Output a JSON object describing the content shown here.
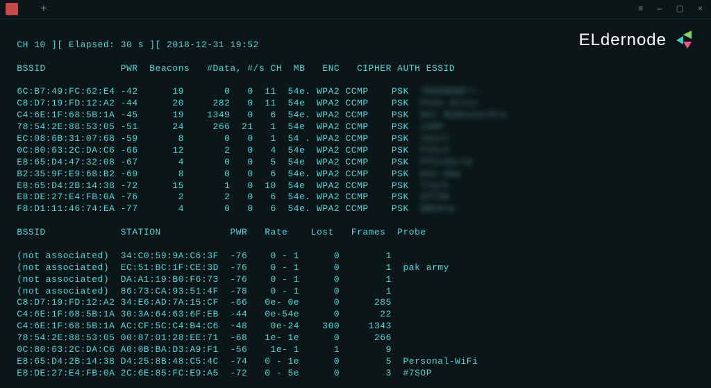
{
  "window": {
    "tab_label": "",
    "new_tab": "+"
  },
  "header_line": " CH 10 ][ Elapsed: 30 s ][ 2018-12-31 19:52",
  "ap_header": {
    "bssid": "BSSID",
    "pwr": "PWR",
    "beacons": "Beacons",
    "data": "#Data,",
    "per_s": "#/s",
    "ch": "CH",
    "mb": "MB",
    "enc": "ENC",
    "cipher": "CIPHER",
    "auth": "AUTH",
    "essid": "ESSID"
  },
  "aps": [
    {
      "bssid": "6C:B7:49:FC:62:E4",
      "pwr": "-42",
      "beacons": "19",
      "data": "0",
      "ps": "0",
      "ch": "11",
      "mb": "54e.",
      "enc": "WPA2",
      "cipher": "CCMP",
      "auth": "PSK",
      "essid": "TRUENODE!!"
    },
    {
      "bssid": "C8:D7:19:FD:12:A2",
      "pwr": "-44",
      "beacons": "20",
      "data": "282",
      "ps": "0",
      "ch": "11",
      "mb": "54e",
      "enc": "WPA2",
      "cipher": "CCMP",
      "auth": "PSK",
      "essid": "Pine Attic"
    },
    {
      "bssid": "C4:6E:1F:68:5B:1A",
      "pwr": "-45",
      "beacons": "19",
      "data": "1349",
      "ps": "0",
      "ch": "6",
      "mb": "54e.",
      "enc": "WPA2",
      "cipher": "CCMP",
      "auth": "PSK",
      "essid": "Net MyRouterPro"
    },
    {
      "bssid": "78:54:2E:88:53:05",
      "pwr": "-51",
      "beacons": "24",
      "data": "266",
      "ps": "21",
      "ch": "1",
      "mb": "54e",
      "enc": "WPA2",
      "cipher": "CCMP",
      "auth": "PSK",
      "essid": "LOOP"
    },
    {
      "bssid": "EC:08:6B:31:07:68",
      "pwr": "-59",
      "beacons": "8",
      "data": "0",
      "ps": "0",
      "ch": "1",
      "mb": "54 .",
      "enc": "WPA2",
      "cipher": "CCMP",
      "auth": "PSK",
      "essid": "Jazz1"
    },
    {
      "bssid": "0C:80:63:2C:DA:C6",
      "pwr": "-66",
      "beacons": "12",
      "data": "2",
      "ps": "0",
      "ch": "4",
      "mb": "54e",
      "enc": "WPA2",
      "cipher": "CCMP",
      "auth": "PSK",
      "essid": "PTCL4"
    },
    {
      "bssid": "E8:65:D4:47:32:08",
      "pwr": "-67",
      "beacons": "4",
      "data": "0",
      "ps": "0",
      "ch": "5",
      "mb": "54e",
      "enc": "WPA2",
      "cipher": "CCMP",
      "auth": "PSK",
      "essid": "PTCLhbLtd"
    },
    {
      "bssid": "B2:35:9F:E9:68:B2",
      "pwr": "-69",
      "beacons": "8",
      "data": "0",
      "ps": "0",
      "ch": "6",
      "mb": "54e.",
      "enc": "WPA2",
      "cipher": "CCMP",
      "auth": "PSK",
      "essid": "Kas-dbw"
    },
    {
      "bssid": "E8:65:D4:2B:14:38",
      "pwr": "-72",
      "beacons": "15",
      "data": "1",
      "ps": "0",
      "ch": "10",
      "mb": "54e",
      "enc": "WPA2",
      "cipher": "CCMP",
      "auth": "PSK",
      "essid": "Tlark"
    },
    {
      "bssid": "E8:DE:27:E4:FB:0A",
      "pwr": "-76",
      "beacons": "2",
      "data": "2",
      "ps": "0",
      "ch": "6",
      "mb": "54e.",
      "enc": "WPA2",
      "cipher": "CCMP",
      "auth": "PSK",
      "essid": "ATTIN"
    },
    {
      "bssid": "F8:D1:11:46:74:EA",
      "pwr": "-77",
      "beacons": "4",
      "data": "0",
      "ps": "0",
      "ch": "6",
      "mb": "54e.",
      "enc": "WPA2",
      "cipher": "CCMP",
      "auth": "PSK",
      "essid": "DBnetw"
    }
  ],
  "station_header": {
    "bssid": "BSSID",
    "station": "STATION",
    "pwr": "PWR",
    "rate": "Rate",
    "lost": "Lost",
    "frames": "Frames",
    "probe": "Probe"
  },
  "stations": [
    {
      "bssid": "(not associated)",
      "station": "34:C0:59:9A:C6:3F",
      "pwr": "-76",
      "rate": "0 - 1",
      "lost": "0",
      "frames": "1",
      "probe": ""
    },
    {
      "bssid": "(not associated)",
      "station": "EC:51:BC:1F:CE:3D",
      "pwr": "-76",
      "rate": "0 - 1",
      "lost": "0",
      "frames": "1",
      "probe": "pak army"
    },
    {
      "bssid": "(not associated)",
      "station": "DA:A1:19:B0:F6:73",
      "pwr": "-76",
      "rate": "0 - 1",
      "lost": "0",
      "frames": "1",
      "probe": ""
    },
    {
      "bssid": "(not associated)",
      "station": "86:73:CA:93:51:4F",
      "pwr": "-78",
      "rate": "0 - 1",
      "lost": "0",
      "frames": "1",
      "probe": ""
    },
    {
      "bssid": "C8:D7:19:FD:12:A2",
      "station": "34:E6:AD:7A:15:CF",
      "pwr": "-66",
      "rate": "0e- 0e",
      "lost": "0",
      "frames": "285",
      "probe": ""
    },
    {
      "bssid": "C4:6E:1F:68:5B:1A",
      "station": "30:3A:64:63:6F:EB",
      "pwr": "-44",
      "rate": "0e-54e",
      "lost": "0",
      "frames": "22",
      "probe": ""
    },
    {
      "bssid": "C4:6E:1F:68:5B:1A",
      "station": "AC:CF:5C:C4:B4:C6",
      "pwr": "-48",
      "rate": "0e-24",
      "lost": "300",
      "frames": "1343",
      "probe": ""
    },
    {
      "bssid": "78:54:2E:88:53:05",
      "station": "00:87:01:28:EE:71",
      "pwr": "-68",
      "rate": "1e- 1e",
      "lost": "0",
      "frames": "266",
      "probe": ""
    },
    {
      "bssid": "0C:80:63:2C:DA:C6",
      "station": "A0:0B:BA:D3:A9:F1",
      "pwr": "-56",
      "rate": "1e- 1",
      "lost": "1",
      "frames": "9",
      "probe": ""
    },
    {
      "bssid": "E8:65:D4:2B:14:38",
      "station": "D4:25:8B:48:C5:4C",
      "pwr": "-74",
      "rate": "0 - 1e",
      "lost": "0",
      "frames": "5",
      "probe": "Personal-WiFi"
    },
    {
      "bssid": "E8:DE:27:E4:FB:0A",
      "station": "2C:6E:85:FC:E9:A5",
      "pwr": "-72",
      "rate": "0 - 5e",
      "lost": "0",
      "frames": "3",
      "probe": "#7SOP"
    }
  ],
  "logo": {
    "text": "ELdernode"
  }
}
